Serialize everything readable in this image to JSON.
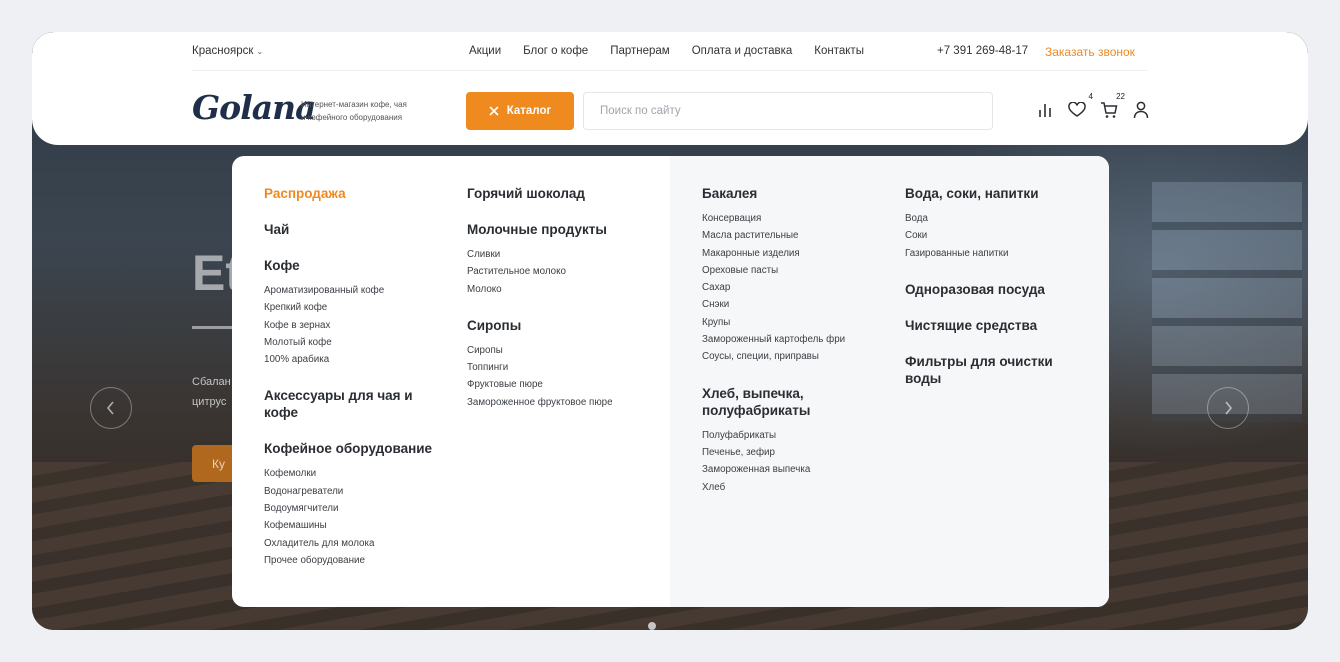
{
  "topbar": {
    "city": "Красноярск",
    "nav": [
      "Акции",
      "Блог о кофе",
      "Партнерам",
      "Оплата и доставка",
      "Контакты"
    ],
    "phone": "+7 391 269-48-17",
    "callback": "Заказать звонок"
  },
  "header": {
    "logo": "Golana",
    "tagline_line1": "Интернет-магазин кофе, чая",
    "tagline_line2": "и кофейного оборудования",
    "catalog_label": "Каталог",
    "search_placeholder": "Поиск по сайту",
    "favorites_count": "4",
    "cart_count": "22"
  },
  "hero": {
    "title_fragment": "Et",
    "text_line1": "Сбалан",
    "text_line2": "цитрус",
    "button_fragment": "Ку"
  },
  "catalog_menu": {
    "col1": {
      "sale": "Распродажа",
      "tea": "Чай",
      "coffee": {
        "title": "Кофе",
        "items": [
          "Ароматизированный кофе",
          "Крепкий кофе",
          "Кофе в зернах",
          "Молотый кофе",
          "100% арабика"
        ]
      },
      "accessories": "Аксессуары для чая и кофе",
      "equipment": {
        "title": "Кофейное оборудование",
        "items": [
          "Кофемолки",
          "Водонагреватели",
          "Водоумягчители",
          "Кофемашины",
          "Охладитель для молока",
          "Прочее оборудование"
        ]
      }
    },
    "col2": {
      "chocolate": "Горячий шоколад",
      "dairy": {
        "title": "Молочные продукты",
        "items": [
          "Сливки",
          "Растительное молоко",
          "Молоко"
        ]
      },
      "syrups": {
        "title": "Сиропы",
        "items": [
          "Сиропы",
          "Топпинги",
          "Фруктовые пюре",
          "Замороженное фруктовое пюре"
        ]
      }
    },
    "col3": {
      "grocery": {
        "title": "Бакалея",
        "items": [
          "Консервация",
          "Масла растительные",
          "Макаронные изделия",
          "Ореховые пасты",
          "Сахар",
          "Снэки",
          "Крупы",
          "Замороженный картофель фри",
          "Соусы, специи, приправы"
        ]
      },
      "bread": {
        "title": "Хлеб, выпечка, полуфабрикаты",
        "items": [
          "Полуфабрикаты",
          "Печенье, зефир",
          "Замороженная выпечка",
          "Хлеб"
        ]
      }
    },
    "col4": {
      "drinks": {
        "title": "Вода, соки, напитки",
        "items": [
          "Вода",
          "Соки",
          "Газированные напитки"
        ]
      },
      "disposable": "Одноразовая посуда",
      "cleaning": "Чистящие средства",
      "filters": "Фильтры для очистки воды"
    }
  },
  "colors": {
    "accent": "#ef8a1f",
    "logo": "#1f2f4a"
  }
}
